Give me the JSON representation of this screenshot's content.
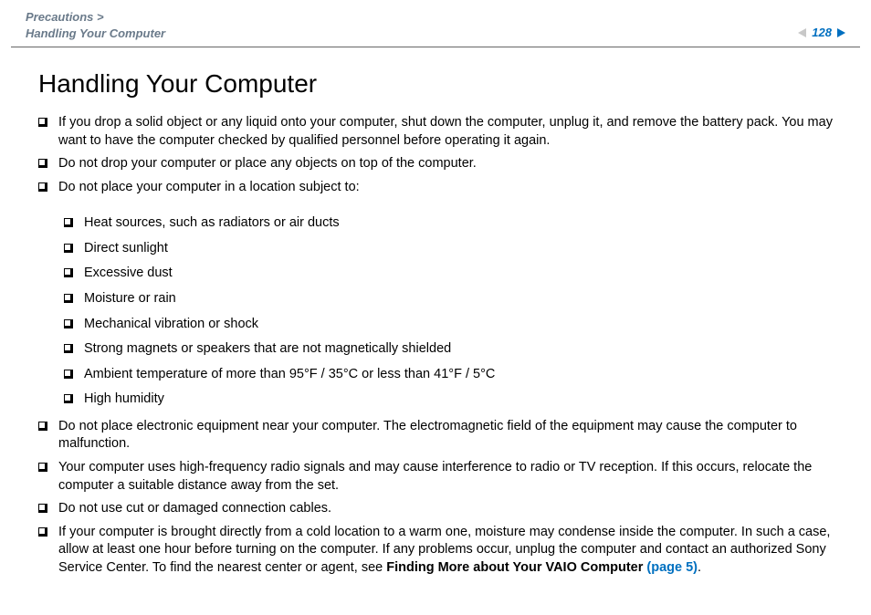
{
  "header": {
    "breadcrumb_line1": "Precautions >",
    "breadcrumb_line2": "Handling Your Computer",
    "page_number": "128"
  },
  "title": "Handling Your Computer",
  "bullets": [
    {
      "text": "If you drop a solid object or any liquid onto your computer, shut down the computer, unplug it, and remove the battery pack. You may want to have the computer checked by qualified personnel before operating it again."
    },
    {
      "text": "Do not drop your computer or place any objects on top of the computer."
    },
    {
      "text": "Do not place your computer in a location subject to:",
      "sub": [
        "Heat sources, such as radiators or air ducts",
        "Direct sunlight",
        "Excessive dust",
        "Moisture or rain",
        "Mechanical vibration or shock",
        "Strong magnets or speakers that are not magnetically shielded",
        "Ambient temperature of more than 95°F / 35°C or less than 41°F / 5°C",
        "High humidity"
      ]
    },
    {
      "text": "Do not place electronic equipment near your computer. The electromagnetic field of the equipment may cause the computer to malfunction."
    },
    {
      "text": "Your computer uses high-frequency radio signals and may cause interference to radio or TV reception. If this occurs, relocate the computer a suitable distance away from the set."
    },
    {
      "text": "Do not use cut or damaged connection cables."
    },
    {
      "text_pre": "If your computer is brought directly from a cold location to a warm one, moisture may condense inside the computer. In such a case, allow at least one hour before turning on the computer. If any problems occur, unplug the computer and contact an authorized Sony Service Center. To find the nearest center or agent, see ",
      "bold": "Finding More about Your VAIO Computer ",
      "link": "(page 5)",
      "tail": "."
    }
  ]
}
